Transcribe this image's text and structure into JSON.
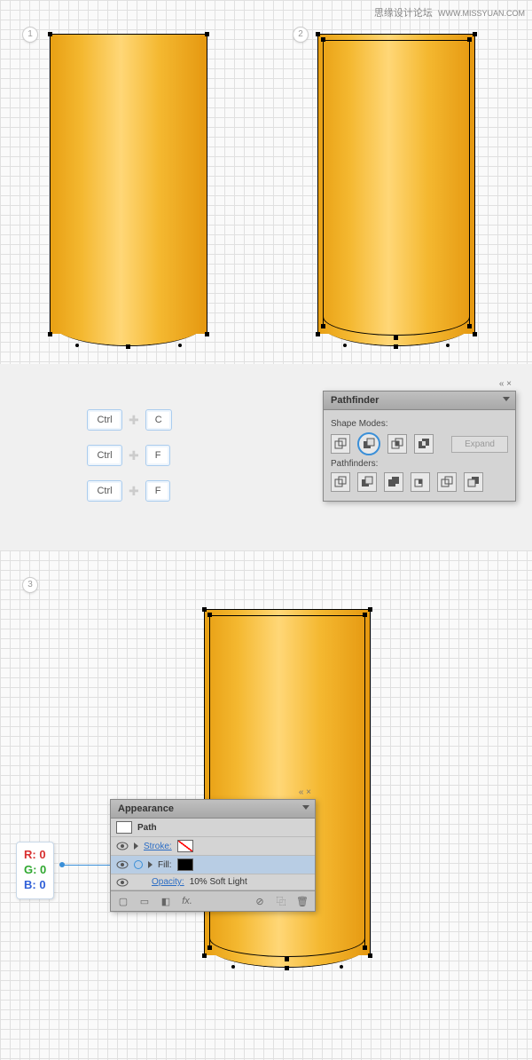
{
  "watermark": {
    "cn": "思缘设计论坛",
    "en": "WWW.MISSYUAN.COM"
  },
  "steps": {
    "s1": "1",
    "s2": "2",
    "s3": "3"
  },
  "keys": {
    "ctrl": "Ctrl",
    "c": "C",
    "f": "F"
  },
  "pathfinder": {
    "title": "Pathfinder",
    "shape_modes": "Shape Modes:",
    "pathfinders": "Pathfinders:",
    "expand": "Expand"
  },
  "appearance": {
    "title": "Appearance",
    "path": "Path",
    "stroke": "Stroke:",
    "fill": "Fill:",
    "opacity_lbl": "Opacity:",
    "opacity_val": "10% Soft Light",
    "fx": "fx."
  },
  "rgb": {
    "r": "R: 0",
    "g": "G: 0",
    "b": "B: 0"
  }
}
